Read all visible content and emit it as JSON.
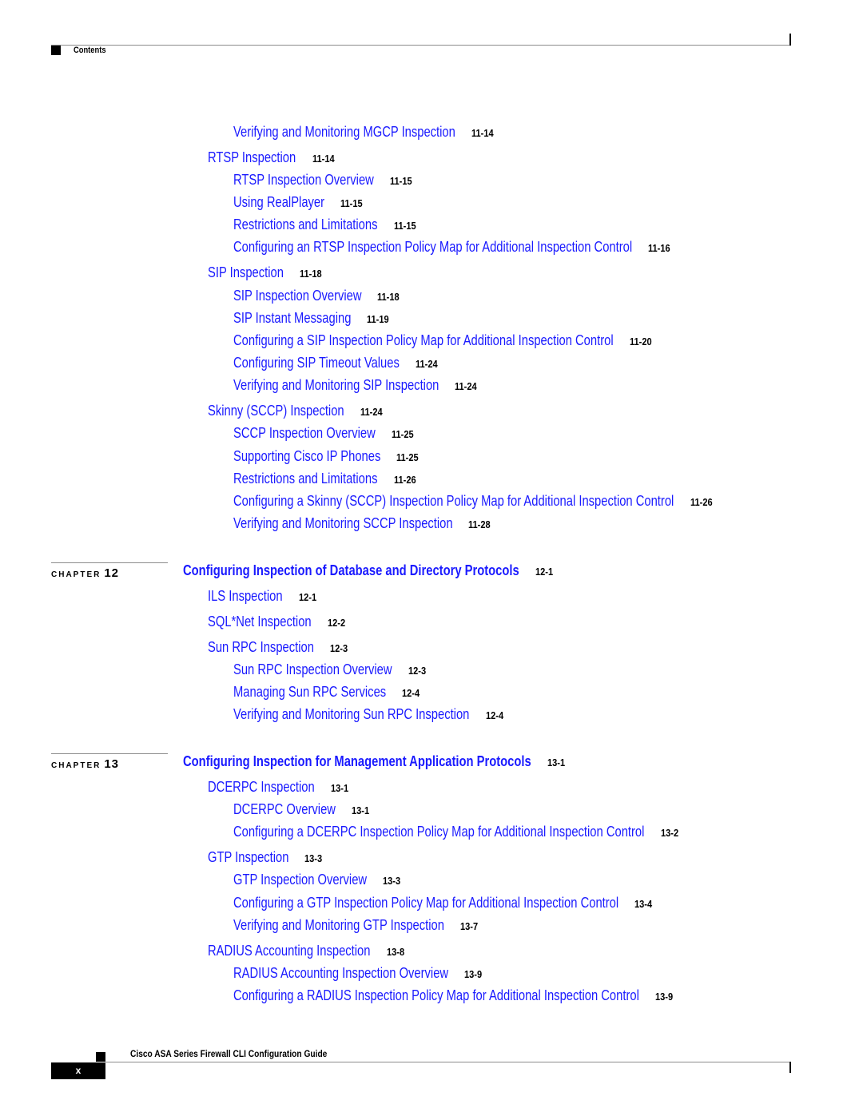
{
  "header": {
    "section": "Contents"
  },
  "footer": {
    "book_title": "Cisco ASA Series Firewall CLI Configuration Guide",
    "page_number": "x"
  },
  "colors": {
    "link": "#1a1aff",
    "text": "#000000",
    "rule": "#8c8c8c"
  },
  "chapter_label": "CHAPTER",
  "entries_top": [
    {
      "title": "Verifying and Monitoring MGCP Inspection",
      "page": "11-14"
    },
    {
      "title": "RTSP Inspection",
      "page": "11-14"
    },
    {
      "title": "RTSP Inspection Overview",
      "page": "11-15"
    },
    {
      "title": "Using RealPlayer",
      "page": "11-15"
    },
    {
      "title": "Restrictions and Limitations",
      "page": "11-15"
    },
    {
      "title": "Configuring an RTSP Inspection Policy Map for Additional Inspection Control",
      "page": "11-16"
    },
    {
      "title": "SIP Inspection",
      "page": "11-18"
    },
    {
      "title": "SIP Inspection Overview",
      "page": "11-18"
    },
    {
      "title": "SIP Instant Messaging",
      "page": "11-19"
    },
    {
      "title": "Configuring a SIP Inspection Policy Map for Additional Inspection Control",
      "page": "11-20"
    },
    {
      "title": "Configuring SIP Timeout Values",
      "page": "11-24"
    },
    {
      "title": "Verifying and Monitoring SIP Inspection",
      "page": "11-24"
    },
    {
      "title": "Skinny (SCCP) Inspection",
      "page": "11-24"
    },
    {
      "title": "SCCP Inspection Overview",
      "page": "11-25"
    },
    {
      "title": "Supporting Cisco IP Phones",
      "page": "11-25"
    },
    {
      "title": "Restrictions and Limitations",
      "page": "11-26"
    },
    {
      "title": "Configuring a Skinny (SCCP) Inspection Policy Map for Additional Inspection Control",
      "page": "11-26"
    },
    {
      "title": "Verifying and Monitoring SCCP Inspection",
      "page": "11-28"
    }
  ],
  "chapters": [
    {
      "number": "12",
      "title": "Configuring Inspection of Database and Directory Protocols",
      "page": "12-1",
      "entries": [
        {
          "title": "ILS Inspection",
          "page": "12-1"
        },
        {
          "title": "SQL*Net Inspection",
          "page": "12-2"
        },
        {
          "title": "Sun RPC Inspection",
          "page": "12-3"
        },
        {
          "title": "Sun RPC Inspection Overview",
          "page": "12-3"
        },
        {
          "title": "Managing Sun RPC Services",
          "page": "12-4"
        },
        {
          "title": "Verifying and Monitoring Sun RPC Inspection",
          "page": "12-4"
        }
      ]
    },
    {
      "number": "13",
      "title": "Configuring Inspection for Management Application Protocols",
      "page": "13-1",
      "entries": [
        {
          "title": "DCERPC Inspection",
          "page": "13-1"
        },
        {
          "title": "DCERPC Overview",
          "page": "13-1"
        },
        {
          "title": "Configuring a DCERPC Inspection Policy Map for Additional Inspection Control",
          "page": "13-2"
        },
        {
          "title": "GTP Inspection",
          "page": "13-3"
        },
        {
          "title": "GTP Inspection Overview",
          "page": "13-3"
        },
        {
          "title": "Configuring a GTP Inspection Policy Map for Additional Inspection Control",
          "page": "13-4"
        },
        {
          "title": "Verifying and Monitoring GTP Inspection",
          "page": "13-7"
        },
        {
          "title": "RADIUS Accounting Inspection",
          "page": "13-8"
        },
        {
          "title": "RADIUS Accounting Inspection Overview",
          "page": "13-9"
        },
        {
          "title": "Configuring a RADIUS Inspection Policy Map for Additional Inspection Control",
          "page": "13-9"
        }
      ]
    }
  ]
}
